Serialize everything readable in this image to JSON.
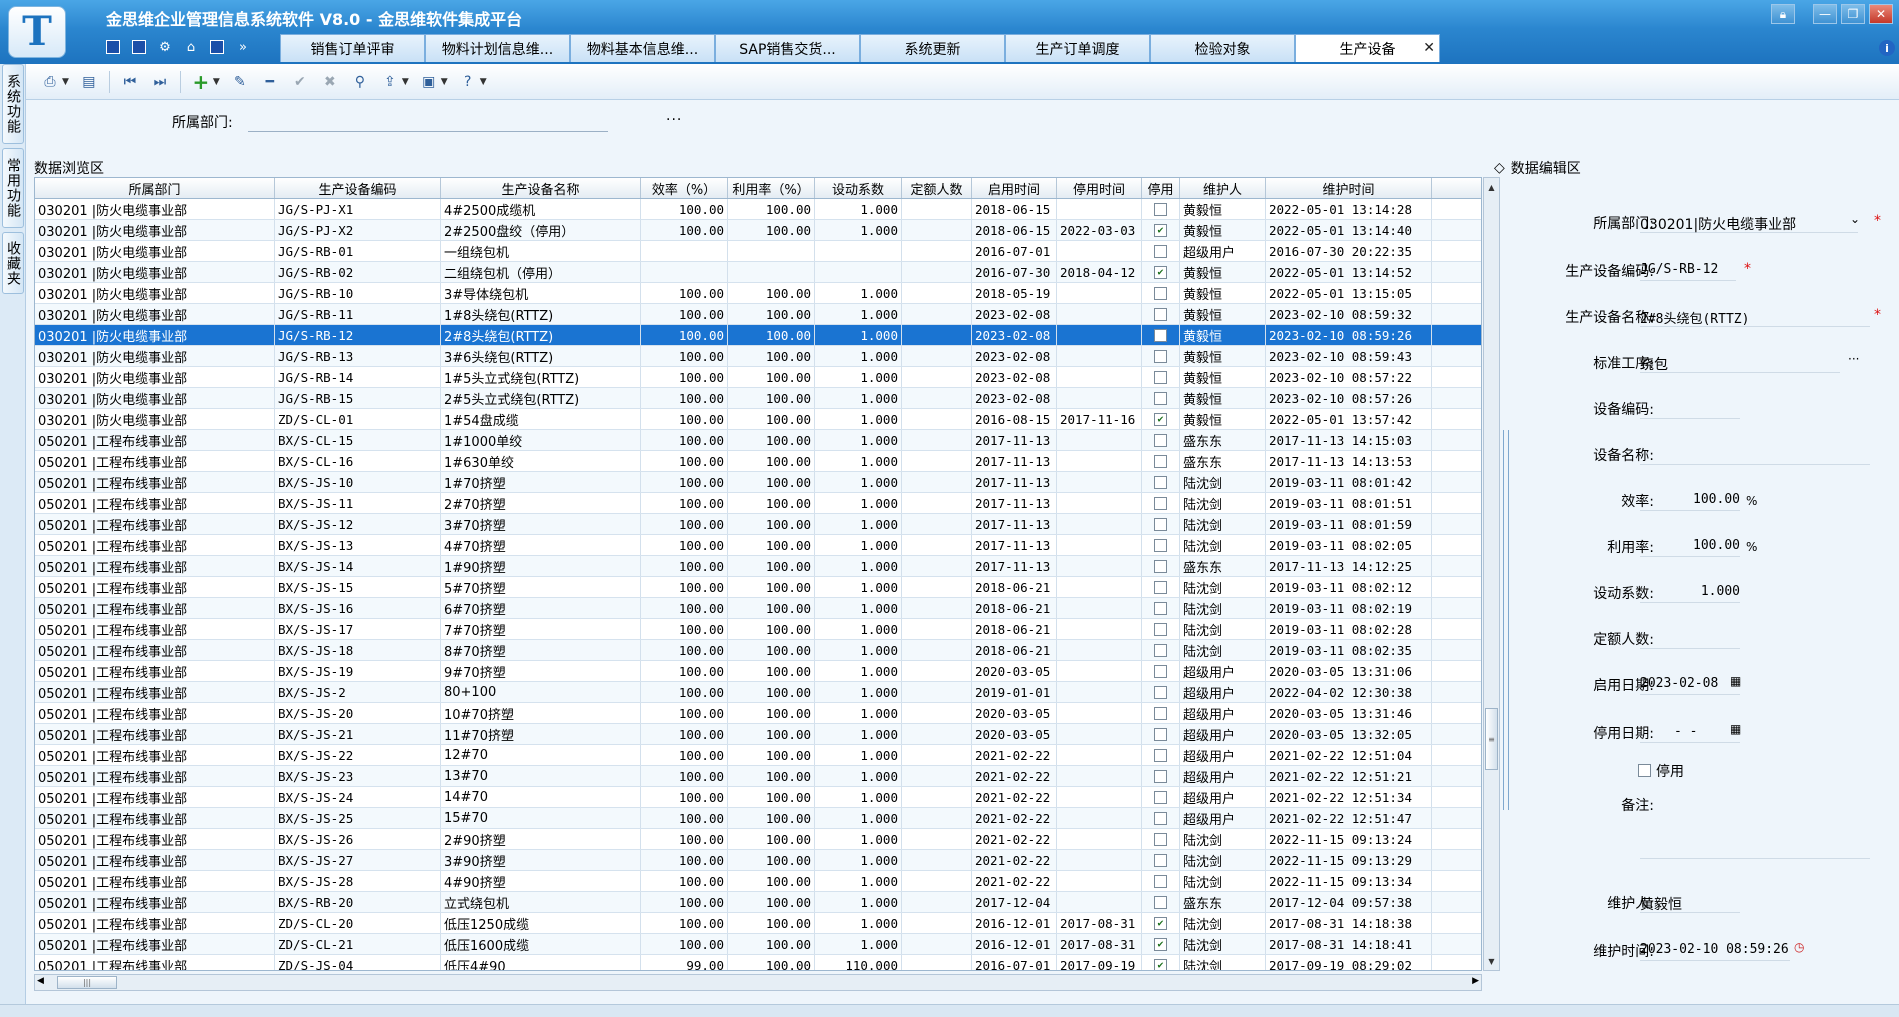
{
  "window": {
    "title": "金思维企业管理信息系统软件 V8.0 - 金思维软件集成平台",
    "logo_letter": "T"
  },
  "tabs": [
    {
      "label": "销售订单评审",
      "active": false
    },
    {
      "label": "物料计划信息维...",
      "active": false
    },
    {
      "label": "物料基本信息维...",
      "active": false
    },
    {
      "label": "SAP销售交货...",
      "active": false
    },
    {
      "label": "系统更新",
      "active": false
    },
    {
      "label": "生产订单调度",
      "active": false
    },
    {
      "label": "检验对象",
      "active": false
    },
    {
      "label": "生产设备",
      "active": true
    }
  ],
  "left_rail": [
    "系统功能",
    "常用功能",
    "收藏夹"
  ],
  "filter": {
    "label": "所属部门:",
    "value": "",
    "more": "···"
  },
  "browse_title": "数据浏览区",
  "edit_title": "数据编辑区",
  "grid": {
    "columns": [
      "所属部门",
      "生产设备编码",
      "生产设备名称",
      "效率（%）",
      "利用率（%）",
      "设动系数",
      "定额人数",
      "启用时间",
      "停用时间",
      "停用",
      "维护人",
      "维护时间"
    ],
    "rows": [
      {
        "dept": "030201 |防火电缆事业部",
        "code": "JG/S-PJ-X1",
        "name": "4#2500成缆机",
        "eff": "100.00",
        "util": "100.00",
        "coef": "1.000",
        "quota": "",
        "start": "2018-06-15",
        "stop": "",
        "disabled": false,
        "maint": "黄毅恒",
        "mtime": "2022-05-01 13:14:28"
      },
      {
        "dept": "030201 |防火电缆事业部",
        "code": "JG/S-PJ-X2",
        "name": "2#2500盘绞（停用）",
        "eff": "100.00",
        "util": "100.00",
        "coef": "1.000",
        "quota": "",
        "start": "2018-06-15",
        "stop": "2022-03-03",
        "disabled": true,
        "maint": "黄毅恒",
        "mtime": "2022-05-01 13:14:40"
      },
      {
        "dept": "030201 |防火电缆事业部",
        "code": "JG/S-RB-01",
        "name": "一组绕包机",
        "eff": "",
        "util": "",
        "coef": "",
        "quota": "",
        "start": "2016-07-01",
        "stop": "",
        "disabled": false,
        "maint": "超级用户",
        "mtime": "2016-07-30 20:22:35"
      },
      {
        "dept": "030201 |防火电缆事业部",
        "code": "JG/S-RB-02",
        "name": "二组绕包机（停用）",
        "eff": "",
        "util": "",
        "coef": "",
        "quota": "",
        "start": "2016-07-30",
        "stop": "2018-04-12",
        "disabled": true,
        "maint": "黄毅恒",
        "mtime": "2022-05-01 13:14:52"
      },
      {
        "dept": "030201 |防火电缆事业部",
        "code": "JG/S-RB-10",
        "name": "3#导体绕包机",
        "eff": "100.00",
        "util": "100.00",
        "coef": "1.000",
        "quota": "",
        "start": "2018-05-19",
        "stop": "",
        "disabled": false,
        "maint": "黄毅恒",
        "mtime": "2022-05-01 13:15:05"
      },
      {
        "dept": "030201 |防火电缆事业部",
        "code": "JG/S-RB-11",
        "name": "1#8头绕包(RTTZ)",
        "eff": "100.00",
        "util": "100.00",
        "coef": "1.000",
        "quota": "",
        "start": "2023-02-08",
        "stop": "",
        "disabled": false,
        "maint": "黄毅恒",
        "mtime": "2023-02-10 08:59:32"
      },
      {
        "dept": "030201 |防火电缆事业部",
        "code": "JG/S-RB-12",
        "name": "2#8头绕包(RTTZ)",
        "eff": "100.00",
        "util": "100.00",
        "coef": "1.000",
        "quota": "",
        "start": "2023-02-08",
        "stop": "",
        "disabled": false,
        "maint": "黄毅恒",
        "mtime": "2023-02-10 08:59:26",
        "selected": true
      },
      {
        "dept": "030201 |防火电缆事业部",
        "code": "JG/S-RB-13",
        "name": "3#6头绕包(RTTZ)",
        "eff": "100.00",
        "util": "100.00",
        "coef": "1.000",
        "quota": "",
        "start": "2023-02-08",
        "stop": "",
        "disabled": false,
        "maint": "黄毅恒",
        "mtime": "2023-02-10 08:59:43"
      },
      {
        "dept": "030201 |防火电缆事业部",
        "code": "JG/S-RB-14",
        "name": "1#5头立式绕包(RTTZ)",
        "eff": "100.00",
        "util": "100.00",
        "coef": "1.000",
        "quota": "",
        "start": "2023-02-08",
        "stop": "",
        "disabled": false,
        "maint": "黄毅恒",
        "mtime": "2023-02-10 08:57:22"
      },
      {
        "dept": "030201 |防火电缆事业部",
        "code": "JG/S-RB-15",
        "name": "2#5头立式绕包(RTTZ)",
        "eff": "100.00",
        "util": "100.00",
        "coef": "1.000",
        "quota": "",
        "start": "2023-02-08",
        "stop": "",
        "disabled": false,
        "maint": "黄毅恒",
        "mtime": "2023-02-10 08:57:26"
      },
      {
        "dept": "030201 |防火电缆事业部",
        "code": "ZD/S-CL-01",
        "name": "1#54盘成缆",
        "eff": "100.00",
        "util": "100.00",
        "coef": "1.000",
        "quota": "",
        "start": "2016-08-15",
        "stop": "2017-11-16",
        "disabled": true,
        "maint": "黄毅恒",
        "mtime": "2022-05-01 13:57:42"
      },
      {
        "dept": "050201 |工程布线事业部",
        "code": "BX/S-CL-15",
        "name": "1#1000单绞",
        "eff": "100.00",
        "util": "100.00",
        "coef": "1.000",
        "quota": "",
        "start": "2017-11-13",
        "stop": "",
        "disabled": false,
        "maint": "盛东东",
        "mtime": "2017-11-13 14:15:03"
      },
      {
        "dept": "050201 |工程布线事业部",
        "code": "BX/S-CL-16",
        "name": "1#630单绞",
        "eff": "100.00",
        "util": "100.00",
        "coef": "1.000",
        "quota": "",
        "start": "2017-11-13",
        "stop": "",
        "disabled": false,
        "maint": "盛东东",
        "mtime": "2017-11-13 14:13:53"
      },
      {
        "dept": "050201 |工程布线事业部",
        "code": "BX/S-JS-10",
        "name": "1#70挤塑",
        "eff": "100.00",
        "util": "100.00",
        "coef": "1.000",
        "quota": "",
        "start": "2017-11-13",
        "stop": "",
        "disabled": false,
        "maint": "陆沈剑",
        "mtime": "2019-03-11 08:01:42"
      },
      {
        "dept": "050201 |工程布线事业部",
        "code": "BX/S-JS-11",
        "name": "2#70挤塑",
        "eff": "100.00",
        "util": "100.00",
        "coef": "1.000",
        "quota": "",
        "start": "2017-11-13",
        "stop": "",
        "disabled": false,
        "maint": "陆沈剑",
        "mtime": "2019-03-11 08:01:51"
      },
      {
        "dept": "050201 |工程布线事业部",
        "code": "BX/S-JS-12",
        "name": "3#70挤塑",
        "eff": "100.00",
        "util": "100.00",
        "coef": "1.000",
        "quota": "",
        "start": "2017-11-13",
        "stop": "",
        "disabled": false,
        "maint": "陆沈剑",
        "mtime": "2019-03-11 08:01:59"
      },
      {
        "dept": "050201 |工程布线事业部",
        "code": "BX/S-JS-13",
        "name": "4#70挤塑",
        "eff": "100.00",
        "util": "100.00",
        "coef": "1.000",
        "quota": "",
        "start": "2017-11-13",
        "stop": "",
        "disabled": false,
        "maint": "陆沈剑",
        "mtime": "2019-03-11 08:02:05"
      },
      {
        "dept": "050201 |工程布线事业部",
        "code": "BX/S-JS-14",
        "name": "1#90挤塑",
        "eff": "100.00",
        "util": "100.00",
        "coef": "1.000",
        "quota": "",
        "start": "2017-11-13",
        "stop": "",
        "disabled": false,
        "maint": "盛东东",
        "mtime": "2017-11-13 14:12:25"
      },
      {
        "dept": "050201 |工程布线事业部",
        "code": "BX/S-JS-15",
        "name": "5#70挤塑",
        "eff": "100.00",
        "util": "100.00",
        "coef": "1.000",
        "quota": "",
        "start": "2018-06-21",
        "stop": "",
        "disabled": false,
        "maint": "陆沈剑",
        "mtime": "2019-03-11 08:02:12"
      },
      {
        "dept": "050201 |工程布线事业部",
        "code": "BX/S-JS-16",
        "name": "6#70挤塑",
        "eff": "100.00",
        "util": "100.00",
        "coef": "1.000",
        "quota": "",
        "start": "2018-06-21",
        "stop": "",
        "disabled": false,
        "maint": "陆沈剑",
        "mtime": "2019-03-11 08:02:19"
      },
      {
        "dept": "050201 |工程布线事业部",
        "code": "BX/S-JS-17",
        "name": "7#70挤塑",
        "eff": "100.00",
        "util": "100.00",
        "coef": "1.000",
        "quota": "",
        "start": "2018-06-21",
        "stop": "",
        "disabled": false,
        "maint": "陆沈剑",
        "mtime": "2019-03-11 08:02:28"
      },
      {
        "dept": "050201 |工程布线事业部",
        "code": "BX/S-JS-18",
        "name": "8#70挤塑",
        "eff": "100.00",
        "util": "100.00",
        "coef": "1.000",
        "quota": "",
        "start": "2018-06-21",
        "stop": "",
        "disabled": false,
        "maint": "陆沈剑",
        "mtime": "2019-03-11 08:02:35"
      },
      {
        "dept": "050201 |工程布线事业部",
        "code": "BX/S-JS-19",
        "name": "9#70挤塑",
        "eff": "100.00",
        "util": "100.00",
        "coef": "1.000",
        "quota": "",
        "start": "2020-03-05",
        "stop": "",
        "disabled": false,
        "maint": "超级用户",
        "mtime": "2020-03-05 13:31:06"
      },
      {
        "dept": "050201 |工程布线事业部",
        "code": "BX/S-JS-2",
        "name": "80+100",
        "eff": "100.00",
        "util": "100.00",
        "coef": "1.000",
        "quota": "",
        "start": "2019-01-01",
        "stop": "",
        "disabled": false,
        "maint": "超级用户",
        "mtime": "2022-04-02 12:30:38"
      },
      {
        "dept": "050201 |工程布线事业部",
        "code": "BX/S-JS-20",
        "name": "10#70挤塑",
        "eff": "100.00",
        "util": "100.00",
        "coef": "1.000",
        "quota": "",
        "start": "2020-03-05",
        "stop": "",
        "disabled": false,
        "maint": "超级用户",
        "mtime": "2020-03-05 13:31:46"
      },
      {
        "dept": "050201 |工程布线事业部",
        "code": "BX/S-JS-21",
        "name": "11#70挤塑",
        "eff": "100.00",
        "util": "100.00",
        "coef": "1.000",
        "quota": "",
        "start": "2020-03-05",
        "stop": "",
        "disabled": false,
        "maint": "超级用户",
        "mtime": "2020-03-05 13:32:05"
      },
      {
        "dept": "050201 |工程布线事业部",
        "code": "BX/S-JS-22",
        "name": "12#70",
        "eff": "100.00",
        "util": "100.00",
        "coef": "1.000",
        "quota": "",
        "start": "2021-02-22",
        "stop": "",
        "disabled": false,
        "maint": "超级用户",
        "mtime": "2021-02-22 12:51:04"
      },
      {
        "dept": "050201 |工程布线事业部",
        "code": "BX/S-JS-23",
        "name": "13#70",
        "eff": "100.00",
        "util": "100.00",
        "coef": "1.000",
        "quota": "",
        "start": "2021-02-22",
        "stop": "",
        "disabled": false,
        "maint": "超级用户",
        "mtime": "2021-02-22 12:51:21"
      },
      {
        "dept": "050201 |工程布线事业部",
        "code": "BX/S-JS-24",
        "name": "14#70",
        "eff": "100.00",
        "util": "100.00",
        "coef": "1.000",
        "quota": "",
        "start": "2021-02-22",
        "stop": "",
        "disabled": false,
        "maint": "超级用户",
        "mtime": "2021-02-22 12:51:34"
      },
      {
        "dept": "050201 |工程布线事业部",
        "code": "BX/S-JS-25",
        "name": "15#70",
        "eff": "100.00",
        "util": "100.00",
        "coef": "1.000",
        "quota": "",
        "start": "2021-02-22",
        "stop": "",
        "disabled": false,
        "maint": "超级用户",
        "mtime": "2021-02-22 12:51:47"
      },
      {
        "dept": "050201 |工程布线事业部",
        "code": "BX/S-JS-26",
        "name": "2#90挤塑",
        "eff": "100.00",
        "util": "100.00",
        "coef": "1.000",
        "quota": "",
        "start": "2021-02-22",
        "stop": "",
        "disabled": false,
        "maint": "陆沈剑",
        "mtime": "2022-11-15 09:13:24"
      },
      {
        "dept": "050201 |工程布线事业部",
        "code": "BX/S-JS-27",
        "name": "3#90挤塑",
        "eff": "100.00",
        "util": "100.00",
        "coef": "1.000",
        "quota": "",
        "start": "2021-02-22",
        "stop": "",
        "disabled": false,
        "maint": "陆沈剑",
        "mtime": "2022-11-15 09:13:29"
      },
      {
        "dept": "050201 |工程布线事业部",
        "code": "BX/S-JS-28",
        "name": "4#90挤塑",
        "eff": "100.00",
        "util": "100.00",
        "coef": "1.000",
        "quota": "",
        "start": "2021-02-22",
        "stop": "",
        "disabled": false,
        "maint": "陆沈剑",
        "mtime": "2022-11-15 09:13:34"
      },
      {
        "dept": "050201 |工程布线事业部",
        "code": "BX/S-RB-20",
        "name": "立式绕包机",
        "eff": "100.00",
        "util": "100.00",
        "coef": "1.000",
        "quota": "",
        "start": "2017-12-04",
        "stop": "",
        "disabled": false,
        "maint": "盛东东",
        "mtime": "2017-12-04 09:57:38"
      },
      {
        "dept": "050201 |工程布线事业部",
        "code": "ZD/S-CL-20",
        "name": "低压1250成缆",
        "eff": "100.00",
        "util": "100.00",
        "coef": "1.000",
        "quota": "",
        "start": "2016-12-01",
        "stop": "2017-08-31",
        "disabled": true,
        "maint": "陆沈剑",
        "mtime": "2017-08-31 14:18:38"
      },
      {
        "dept": "050201 |工程布线事业部",
        "code": "ZD/S-CL-21",
        "name": "低压1600成缆",
        "eff": "100.00",
        "util": "100.00",
        "coef": "1.000",
        "quota": "",
        "start": "2016-12-01",
        "stop": "2017-08-31",
        "disabled": true,
        "maint": "陆沈剑",
        "mtime": "2017-08-31 14:18:41"
      },
      {
        "dept": "050201 |工程布线事业部",
        "code": "ZD/S-JS-04",
        "name": "低压4#90",
        "eff": "99.00",
        "util": "100.00",
        "coef": "110.000",
        "quota": "",
        "start": "2016-07-01",
        "stop": "2017-09-19",
        "disabled": true,
        "maint": "陆沈剑",
        "mtime": "2017-09-19 08:29:02"
      }
    ]
  },
  "form": {
    "dept": {
      "label": "所属部门:",
      "value": "030201|防火电缆事业部"
    },
    "code": {
      "label": "生产设备编码:",
      "value": "JG/S-RB-12"
    },
    "name": {
      "label": "生产设备名称:",
      "value": "2#8头绕包(RTTZ)"
    },
    "process": {
      "label": "标准工序:",
      "value": "绕包",
      "more": "···"
    },
    "equip_code": {
      "label": "设备编码:",
      "value": ""
    },
    "equip_name": {
      "label": "设备名称:",
      "value": ""
    },
    "eff": {
      "label": "效率:",
      "value": "100.00",
      "unit": "%"
    },
    "util": {
      "label": "利用率:",
      "value": "100.00",
      "unit": "%"
    },
    "coef": {
      "label": "设动系数:",
      "value": "1.000"
    },
    "quota": {
      "label": "定额人数:",
      "value": ""
    },
    "start": {
      "label": "启用日期:",
      "value": "2023-02-08"
    },
    "stop": {
      "label": "停用日期:",
      "value": "- -"
    },
    "disabled": {
      "label": "停用",
      "checked": false
    },
    "remark": {
      "label": "备注:",
      "value": ""
    },
    "maint": {
      "label": "维护人:",
      "value": "黄毅恒"
    },
    "mtime": {
      "label": "维护时间:",
      "value": "2023-02-10 08:59:26"
    }
  },
  "icons": {
    "print": "printer-icon",
    "first": "first-record-icon",
    "last": "last-record-icon",
    "add": "add-icon",
    "edit": "edit-icon",
    "delete": "minus-icon",
    "confirm": "check-icon",
    "cancel": "cancel-icon",
    "attach": "attach-icon",
    "export": "export-icon",
    "save": "save-icon",
    "help": "help-icon"
  }
}
